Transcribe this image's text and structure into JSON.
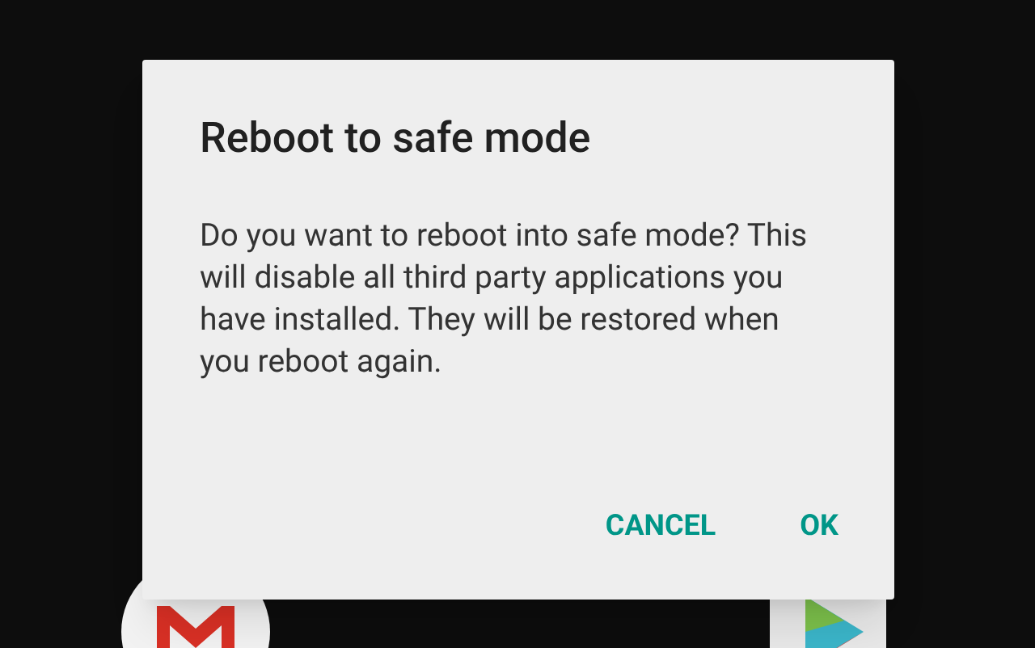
{
  "dialog": {
    "title": "Reboot to safe mode",
    "message": "Do you want to reboot into safe mode? This will disable all third party applications you have installed. They will be restored when you reboot again.",
    "buttons": [
      {
        "label": "CANCEL"
      },
      {
        "label": "OK"
      }
    ]
  }
}
